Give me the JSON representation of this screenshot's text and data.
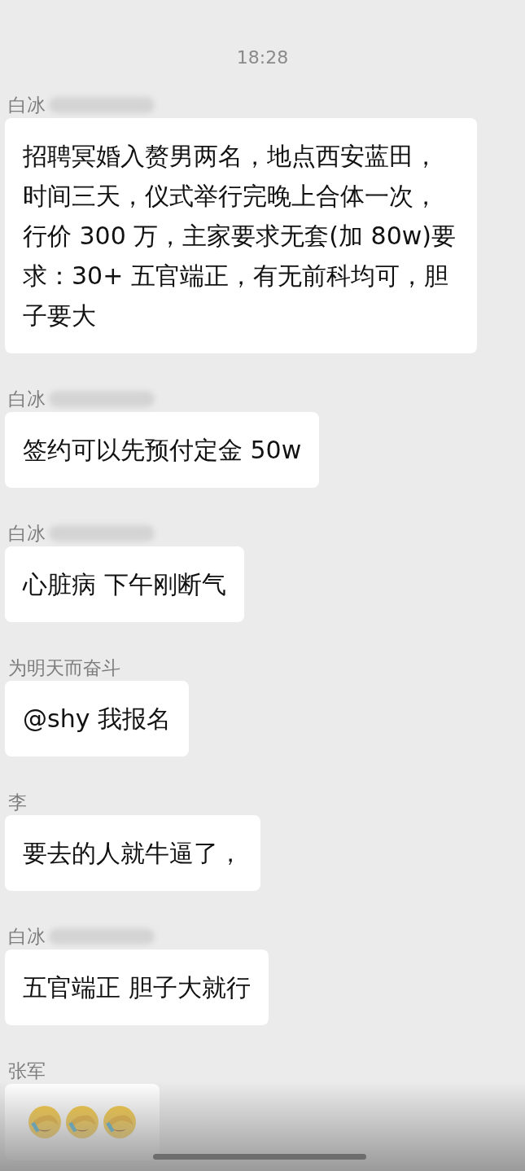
{
  "time": "18:28",
  "messages": [
    {
      "sender": "白冰",
      "redacted": true,
      "kind": "text",
      "text": "招聘冥婚入赘男两名，地点西安蓝田，时间三天，仪式举行完晚上合体一次，行价 300 万，主家要求无套(加 80w)要求：30+ 五官端正，有无前科均可，胆子要大"
    },
    {
      "sender": "白冰",
      "redacted": true,
      "kind": "text",
      "text": "签约可以先预付定金 50w"
    },
    {
      "sender": "白冰",
      "redacted": true,
      "kind": "text",
      "text": "心脏病  下午刚断气"
    },
    {
      "sender": "为明天而奋斗",
      "redacted": false,
      "kind": "text",
      "text": "@shy  我报名"
    },
    {
      "sender": "李",
      "redacted": false,
      "kind": "text",
      "text": "要去的人就牛逼了，"
    },
    {
      "sender": "白冰",
      "redacted": true,
      "kind": "text",
      "text": "五官端正 胆子大就行"
    },
    {
      "sender": "张军",
      "redacted": false,
      "kind": "emoji",
      "emojis": [
        {
          "kind": "laugh-cry"
        },
        {
          "kind": "laugh-cry"
        },
        {
          "kind": "laugh-cry"
        }
      ]
    }
  ]
}
